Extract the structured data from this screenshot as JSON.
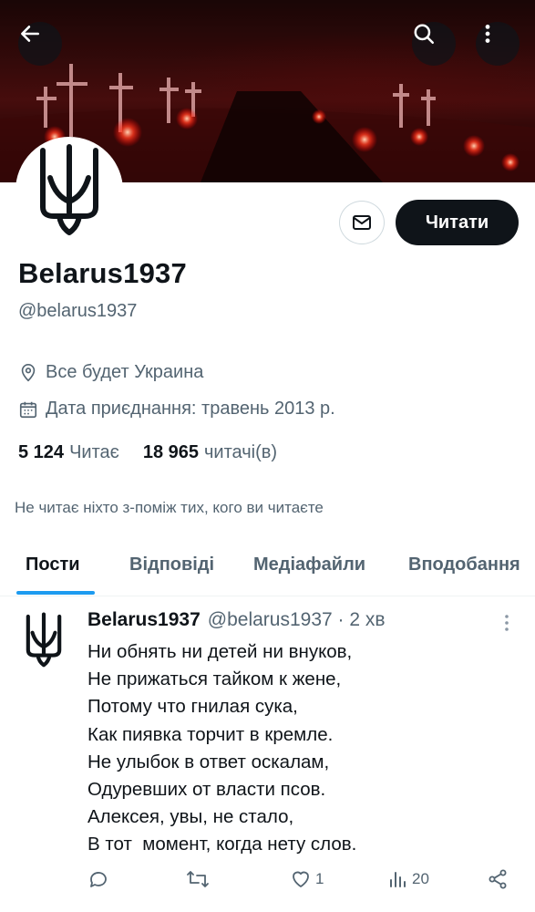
{
  "header": {
    "back_icon": "arrow-left-icon",
    "search_icon": "search-icon",
    "more_icon": "more-vertical-icon"
  },
  "profile": {
    "display_name": "Belarus1937",
    "handle": "@belarus1937",
    "location": "Все будет Украина",
    "joined": "Дата приєднання: травень 2013 р.",
    "following_count": "5 124",
    "following_label": "Читає",
    "followers_count": "18 965",
    "followers_label": "читачі(в)",
    "not_followed_note": "Не читає ніхто з-поміж тих, кого ви читаєте",
    "follow_button": "Читати"
  },
  "tabs": [
    {
      "label": "Пости"
    },
    {
      "label": "Відповіді"
    },
    {
      "label": "Медіафайли"
    },
    {
      "label": "Вподобання"
    }
  ],
  "tweet": {
    "author": "Belarus1937",
    "handle_time": "@belarus1937 · 2 хв",
    "text": "Ни обнять ни детей ни внуков,\nНе прижаться тайком к жене,\nПотому что гнилая сука,\nКак пиявка торчит в кремле.\nНе улыбок в ответ оскалам,\nОдуревших от власти псов.\nАлексея, увы, не стало,\nВ тот  момент, когда нету слов.",
    "likes": "1",
    "views": "20"
  },
  "colors": {
    "accent": "#1d9bf0",
    "text": "#0f1419",
    "muted": "#536471"
  }
}
